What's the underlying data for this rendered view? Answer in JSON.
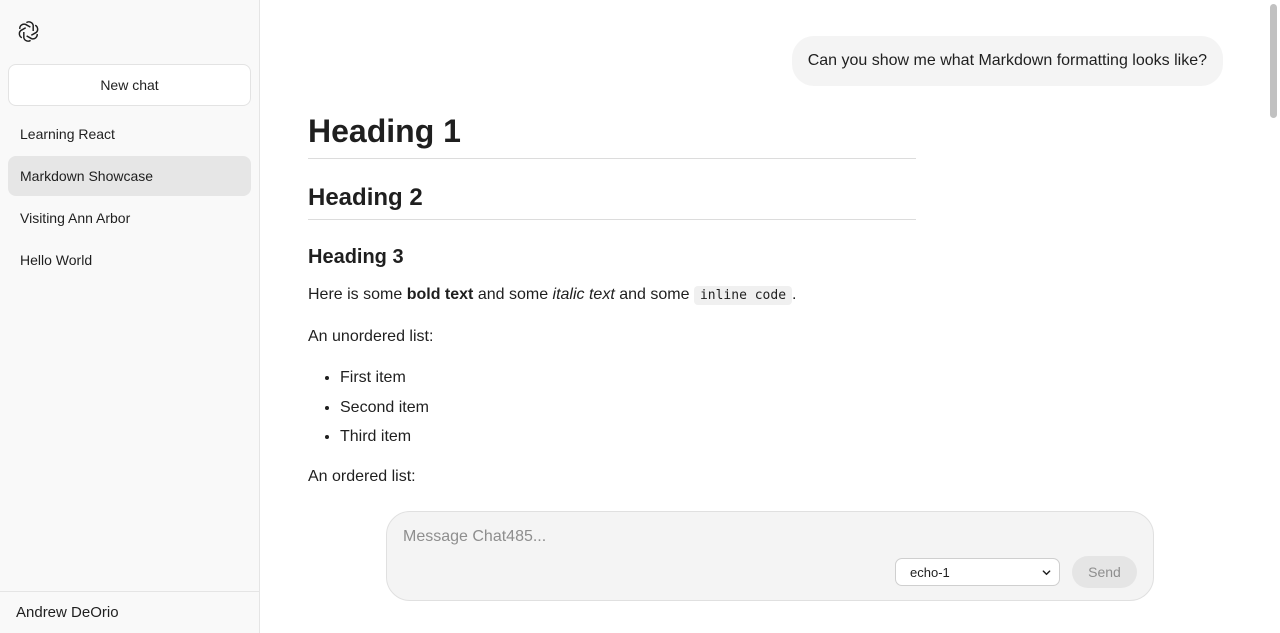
{
  "sidebar": {
    "new_chat_label": "New chat",
    "chats": [
      {
        "label": "Learning React",
        "active": false
      },
      {
        "label": "Markdown Showcase",
        "active": true
      },
      {
        "label": "Visiting Ann Arbor",
        "active": false
      },
      {
        "label": "Hello World",
        "active": false
      }
    ],
    "user_name": "Andrew DeOrio",
    "logo_icon": "openai-logo-icon"
  },
  "conversation": {
    "user_message": "Can you show me what Markdown formatting looks like?",
    "assistant": {
      "h1": "Heading 1",
      "h2": "Heading 2",
      "h3": "Heading 3",
      "para_prefix": "Here is some ",
      "bold_text": "bold text",
      "para_mid1": " and some ",
      "italic_text": "italic text",
      "para_mid2": " and some ",
      "inline_code": "inline code",
      "para_suffix": ".",
      "unordered_intro": "An unordered list:",
      "unordered_items": [
        "First item",
        "Second item",
        "Third item"
      ],
      "ordered_intro": "An ordered list:"
    }
  },
  "composer": {
    "placeholder": "Message Chat485...",
    "model_selected": "echo-1",
    "send_label": "Send"
  },
  "colors": {
    "sidebar_bg": "#f9f9f9",
    "active_item_bg": "#e6e6e6",
    "bubble_bg": "#f4f4f4"
  }
}
